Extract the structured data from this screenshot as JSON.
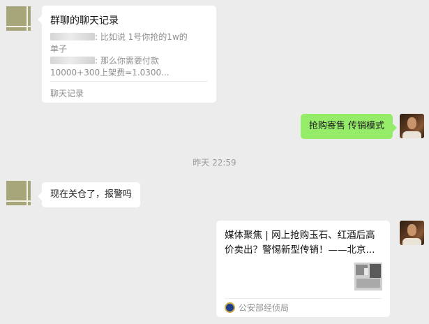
{
  "chat_record": {
    "title": "群聊的聊天记录",
    "line1_text": ": 比如说 1号你抢的1w的",
    "line1_cont": "单子",
    "line2_text": ": 那么你需要付款",
    "line2_cont": "10000+300上架费=1.0300...",
    "footer": "聊天记录"
  },
  "sent_message": "抢购寄售 传销模式",
  "timestamp": "昨天 22:59",
  "received_message": "现在关仓了，报警吗",
  "link_card": {
    "title": "媒体聚焦 | 网上抢购玉石、红酒后高价卖出？警惕新型传销！——北京...",
    "source": "公安部经侦局"
  },
  "colors": {
    "background": "#ececec",
    "sent_bubble": "#95ec69",
    "received_bubble": "#ffffff",
    "muted_text": "#8f8f8f"
  }
}
